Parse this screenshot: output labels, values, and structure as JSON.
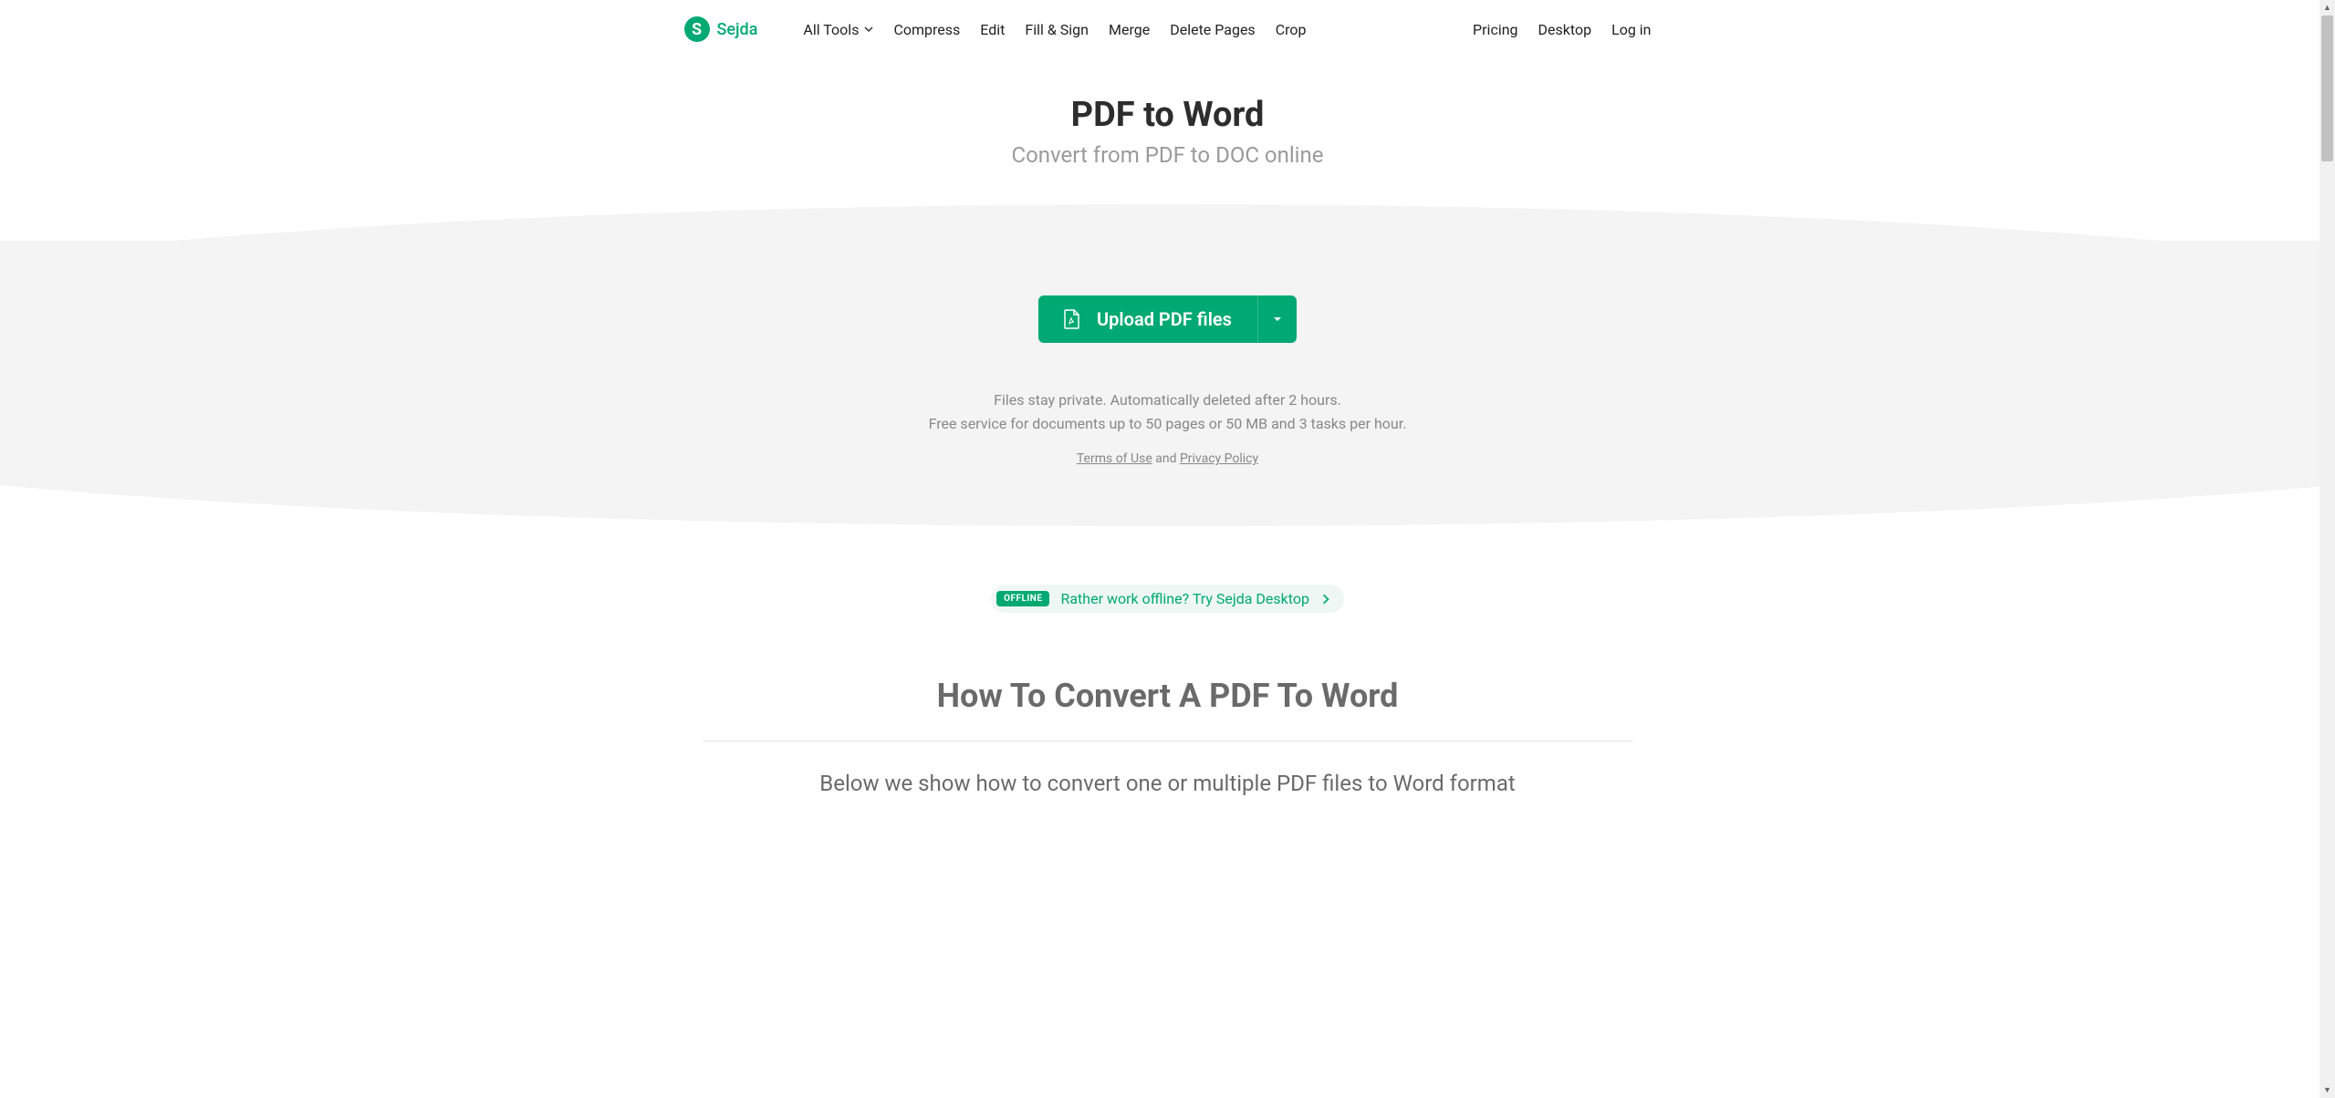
{
  "brand": {
    "name": "Sejda",
    "logo_letter": "S"
  },
  "nav": {
    "all_tools": "All Tools",
    "compress": "Compress",
    "edit": "Edit",
    "fill_sign": "Fill & Sign",
    "merge": "Merge",
    "delete_pages": "Delete Pages",
    "crop": "Crop",
    "pricing": "Pricing",
    "desktop": "Desktop",
    "login": "Log in"
  },
  "hero": {
    "title": "PDF to Word",
    "subtitle": "Convert from PDF to DOC online"
  },
  "upload": {
    "label": "Upload PDF files"
  },
  "info": {
    "line1": "Files stay private. Automatically deleted after 2 hours.",
    "line2": "Free service for documents up to 50 pages or 50 MB and 3 tasks per hour."
  },
  "legal": {
    "terms": "Terms of Use",
    "and": " and ",
    "privacy": "Privacy Policy"
  },
  "offline": {
    "badge": "OFFLINE",
    "text": "Rather work offline? Try Sejda Desktop"
  },
  "howto": {
    "heading": "How To Convert A PDF To Word",
    "lead": "Below we show how to convert one or multiple PDF files to Word format"
  }
}
